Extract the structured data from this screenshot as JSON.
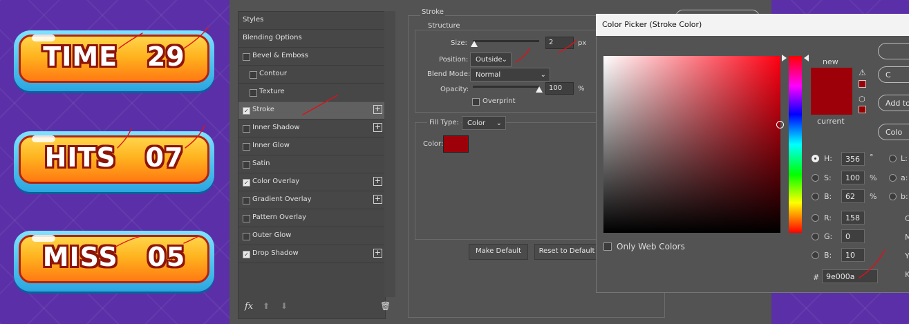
{
  "game_buttons": [
    {
      "label": "TIME",
      "value": "29"
    },
    {
      "label": "HITS",
      "value": "07"
    },
    {
      "label": "MISS",
      "value": "05"
    }
  ],
  "layer_style": {
    "styles": [
      {
        "label": "Styles",
        "checkbox": false,
        "checked": false,
        "plus": false,
        "selected": false,
        "indent": false
      },
      {
        "label": "Blending Options",
        "checkbox": false,
        "checked": false,
        "plus": false,
        "selected": false,
        "indent": false
      },
      {
        "label": "Bevel & Emboss",
        "checkbox": true,
        "checked": false,
        "plus": false,
        "selected": false,
        "indent": false
      },
      {
        "label": "Contour",
        "checkbox": true,
        "checked": false,
        "plus": false,
        "selected": false,
        "indent": true
      },
      {
        "label": "Texture",
        "checkbox": true,
        "checked": false,
        "plus": false,
        "selected": false,
        "indent": true
      },
      {
        "label": "Stroke",
        "checkbox": true,
        "checked": true,
        "plus": true,
        "selected": true,
        "indent": false
      },
      {
        "label": "Inner Shadow",
        "checkbox": true,
        "checked": false,
        "plus": true,
        "selected": false,
        "indent": false
      },
      {
        "label": "Inner Glow",
        "checkbox": true,
        "checked": false,
        "plus": false,
        "selected": false,
        "indent": false
      },
      {
        "label": "Satin",
        "checkbox": true,
        "checked": false,
        "plus": false,
        "selected": false,
        "indent": false
      },
      {
        "label": "Color Overlay",
        "checkbox": true,
        "checked": true,
        "plus": true,
        "selected": false,
        "indent": false
      },
      {
        "label": "Gradient Overlay",
        "checkbox": true,
        "checked": false,
        "plus": true,
        "selected": false,
        "indent": false
      },
      {
        "label": "Pattern Overlay",
        "checkbox": true,
        "checked": false,
        "plus": false,
        "selected": false,
        "indent": false
      },
      {
        "label": "Outer Glow",
        "checkbox": true,
        "checked": false,
        "plus": false,
        "selected": false,
        "indent": false
      },
      {
        "label": "Drop Shadow",
        "checkbox": true,
        "checked": true,
        "plus": true,
        "selected": false,
        "indent": false
      }
    ],
    "footer": {
      "fx_label": "fx",
      "up_icon": "arrow-up-icon",
      "down_icon": "arrow-down-icon",
      "trash_icon": "trash-icon"
    },
    "stroke": {
      "section_title": "Stroke",
      "structure_title": "Structure",
      "size_label": "Size:",
      "size_value": "2",
      "size_unit": "px",
      "size_level": 0.02,
      "position_label": "Position:",
      "position_value": "Outside",
      "blend_mode_label": "Blend Mode:",
      "blend_mode_value": "Normal",
      "opacity_label": "Opacity:",
      "opacity_value": "100",
      "opacity_unit": "%",
      "opacity_level": 1.0,
      "overprint_label": "Overprint",
      "overprint_checked": false,
      "fill_type_label": "Fill Type:",
      "fill_type_value": "Color",
      "color_label": "Color:",
      "color_hex": "#9e000a"
    },
    "make_default_label": "Make Default",
    "reset_default_label": "Reset to Default"
  },
  "color_picker": {
    "title": "Color Picker (Stroke Color)",
    "new_label": "new",
    "current_label": "current",
    "new_color": "#9e000a",
    "current_color": "#9e000a",
    "only_web_colors_label": "Only Web Colors",
    "only_web_colors_checked": false,
    "hsb": [
      {
        "label": "H:",
        "value": "356",
        "unit": "°",
        "selected": true
      },
      {
        "label": "S:",
        "value": "100",
        "unit": "%",
        "selected": false
      },
      {
        "label": "B:",
        "value": "62",
        "unit": "%",
        "selected": false
      }
    ],
    "rgb": [
      {
        "label": "R:",
        "value": "158"
      },
      {
        "label": "G:",
        "value": "0"
      },
      {
        "label": "B:",
        "value": "10"
      }
    ],
    "lab_labels": [
      "L:",
      "a:",
      "b:"
    ],
    "cmyk_letters": [
      "C",
      "M",
      "Y",
      "K"
    ],
    "hex_label": "#",
    "hex_value": "9e000a",
    "buttons": [
      {
        "label": "",
        "name": "ok-button"
      },
      {
        "label": "C",
        "name": "cancel-button"
      },
      {
        "label": "Add to",
        "name": "add-to-swatches-button"
      },
      {
        "label": "Colo",
        "name": "color-libraries-button"
      }
    ],
    "hue_level": 0.011
  }
}
